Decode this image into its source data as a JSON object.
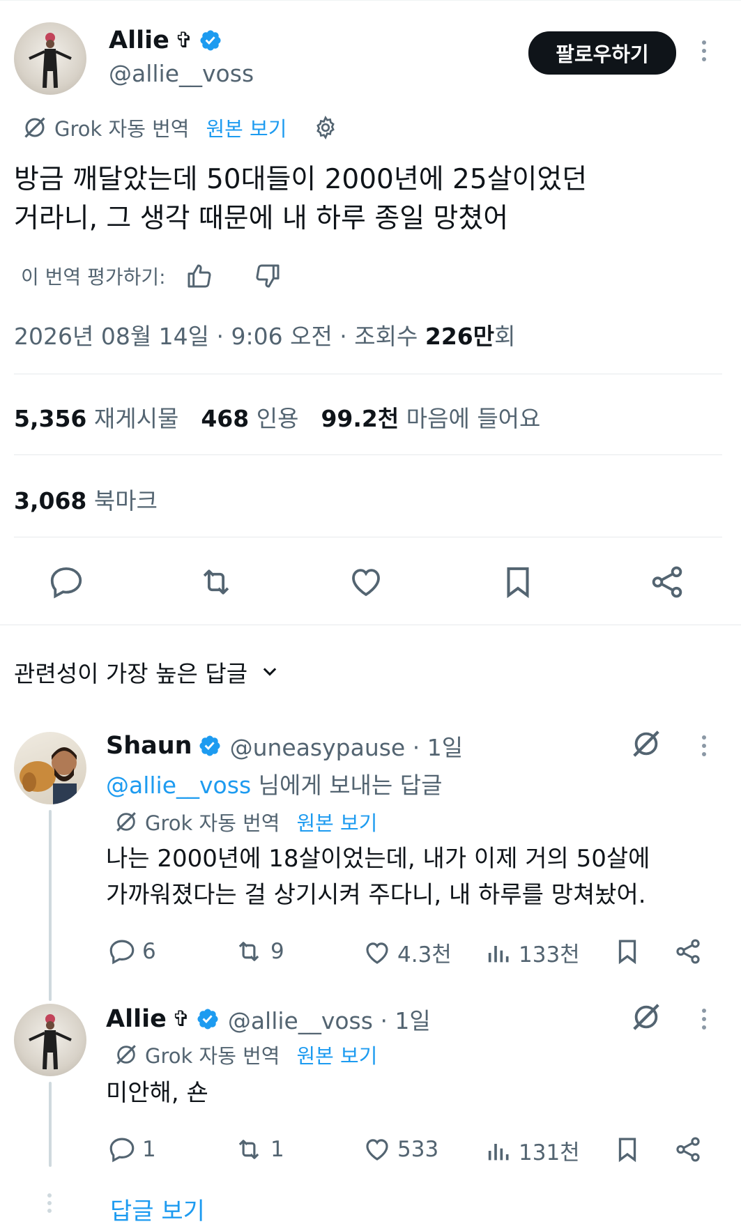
{
  "post": {
    "author_name": "Allie",
    "author_symbol": "✞",
    "handle": "@allie__voss",
    "follow_label": "팔로우하기",
    "grok_label": "Grok 자동 번역",
    "view_original": "원본 보기",
    "text_line1": "방금 깨달았는데 50대들이 2000년에 25살이었던",
    "text_line2": "거라니, 그 생각 때문에 내 하루 종일 망쳤어",
    "rate_label": "이 번역 평가하기:",
    "meta_date": "2026년 08월 14일 · 9:06 오전 · 조회수 ",
    "meta_views": "226만",
    "meta_views_unit": "회",
    "reposts_count": "5,356",
    "reposts_label": "재게시물",
    "quotes_count": "468",
    "quotes_label": "인용",
    "likes_count": "99.2천",
    "likes_label": "마음에 들어요",
    "bookmarks_count": "3,068",
    "bookmarks_label": "북마크"
  },
  "replies_sort_label": "관련성이 가장 높은 답글",
  "replies": [
    {
      "name": "Shaun",
      "handle_time": "@uneasypause · 1일",
      "replying_to_handle": "@allie__voss",
      "replying_to_suffix": " 님에게 보내는 답글",
      "grok_label": "Grok 자동 번역",
      "view_original": "원본 보기",
      "text_line1": "나는 2000년에 18살이었는데, 내가 이제 거의 50살에",
      "text_line2": "가까워졌다는 걸 상기시켜 주다니, 내 하루를 망쳐놨어.",
      "comments": "6",
      "retweets": "9",
      "likes": "4.3천",
      "views": "133천"
    },
    {
      "name": "Allie",
      "symbol": "✞",
      "handle_time": "@allie__voss · 1일",
      "grok_label": "Grok 자동 번역",
      "view_original": "원본 보기",
      "text_line1": "미안해, 숀",
      "comments": "1",
      "retweets": "1",
      "likes": "533",
      "views": "131천"
    }
  ],
  "show_replies_label": "답글 보기",
  "colors": {
    "accent": "#1d9bf0",
    "text": "#0f1419",
    "secondary": "#536471"
  }
}
